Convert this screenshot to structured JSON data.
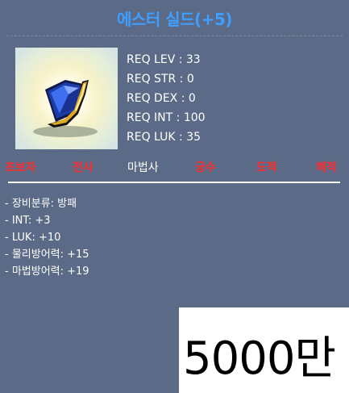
{
  "item": {
    "name": "에스터 실드(+5)",
    "icon_name": "shield-icon"
  },
  "requirements": [
    {
      "text": "REQ LEV : 33"
    },
    {
      "text": "REQ STR : 0"
    },
    {
      "text": "REQ DEX : 0"
    },
    {
      "text": "REQ INT : 100"
    },
    {
      "text": "REQ LUK : 35"
    }
  ],
  "jobs": [
    {
      "label": "초보자",
      "allowed": false
    },
    {
      "label": "전사",
      "allowed": false
    },
    {
      "label": "마법사",
      "allowed": true
    },
    {
      "label": "궁수",
      "allowed": false
    },
    {
      "label": "도적",
      "allowed": false
    },
    {
      "label": "해적",
      "allowed": false
    }
  ],
  "properties": [
    {
      "text": "- 장비분류: 방패"
    },
    {
      "text": "- INT: +3"
    },
    {
      "text": "- LUK: +10"
    },
    {
      "text": "- 물리방어력: +15"
    },
    {
      "text": "- 마법방어력: +19"
    }
  ],
  "price": {
    "text": "5000만"
  },
  "colors": {
    "tooltip_bg": "#5a6a87",
    "title": "#3f9fff",
    "job_disallowed": "#ff2a2a",
    "job_allowed": "#ffffff"
  }
}
